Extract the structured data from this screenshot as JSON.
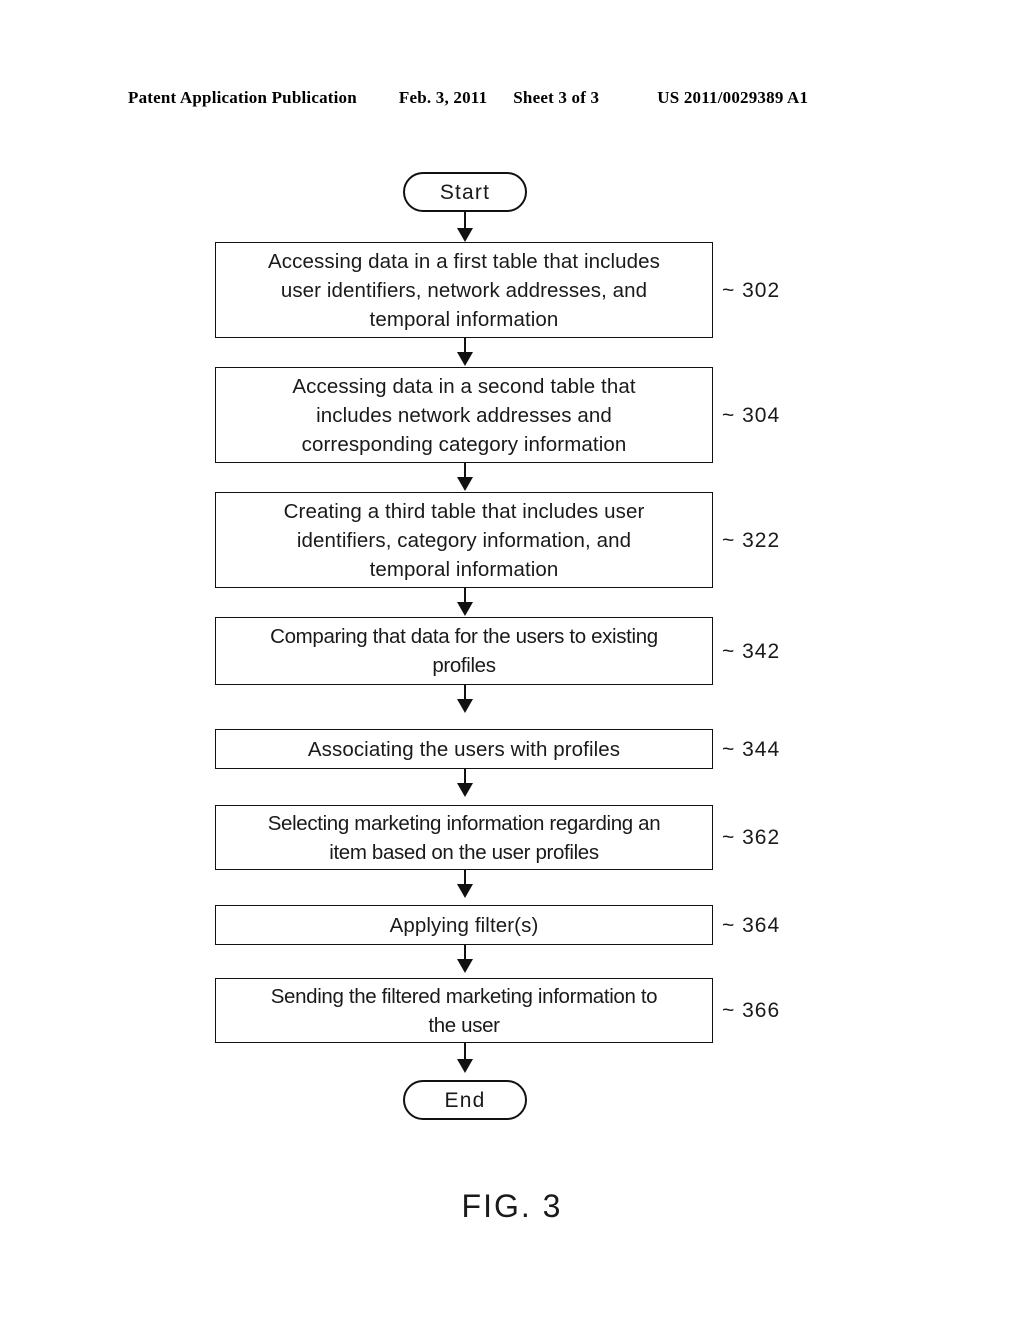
{
  "header": {
    "publication": "Patent Application Publication",
    "date": "Feb. 3, 2011",
    "sheet": "Sheet 3 of 3",
    "document_number": "US 2011/0029389 A1"
  },
  "figure": {
    "caption": "FIG. 3",
    "start_label": "Start",
    "end_label": "End"
  },
  "flowchart": {
    "type": "flowchart",
    "steps": [
      {
        "ref": "~ 302",
        "text": "Accessing data in a first table that includes\nuser identifiers, network addresses, and\ntemporal information"
      },
      {
        "ref": "~ 304",
        "text": "Accessing data in a second table that\nincludes network addresses and\ncorresponding category information"
      },
      {
        "ref": "~ 322",
        "text": "Creating a third table that includes user\nidentifiers, category information, and\ntemporal information"
      },
      {
        "ref": "~ 342",
        "text": "Comparing that data for the users to existing\nprofiles"
      },
      {
        "ref": "~ 344",
        "text": "Associating the users with profiles"
      },
      {
        "ref": "~ 362",
        "text": "Selecting marketing information regarding an\nitem based on the user profiles"
      },
      {
        "ref": "~ 364",
        "text": "Applying filter(s)"
      },
      {
        "ref": "~ 366",
        "text": "Sending the filtered marketing information to\nthe user"
      }
    ]
  },
  "colors": {
    "ink": "#1a1a1a",
    "line": "#111111",
    "paper": "#ffffff"
  }
}
